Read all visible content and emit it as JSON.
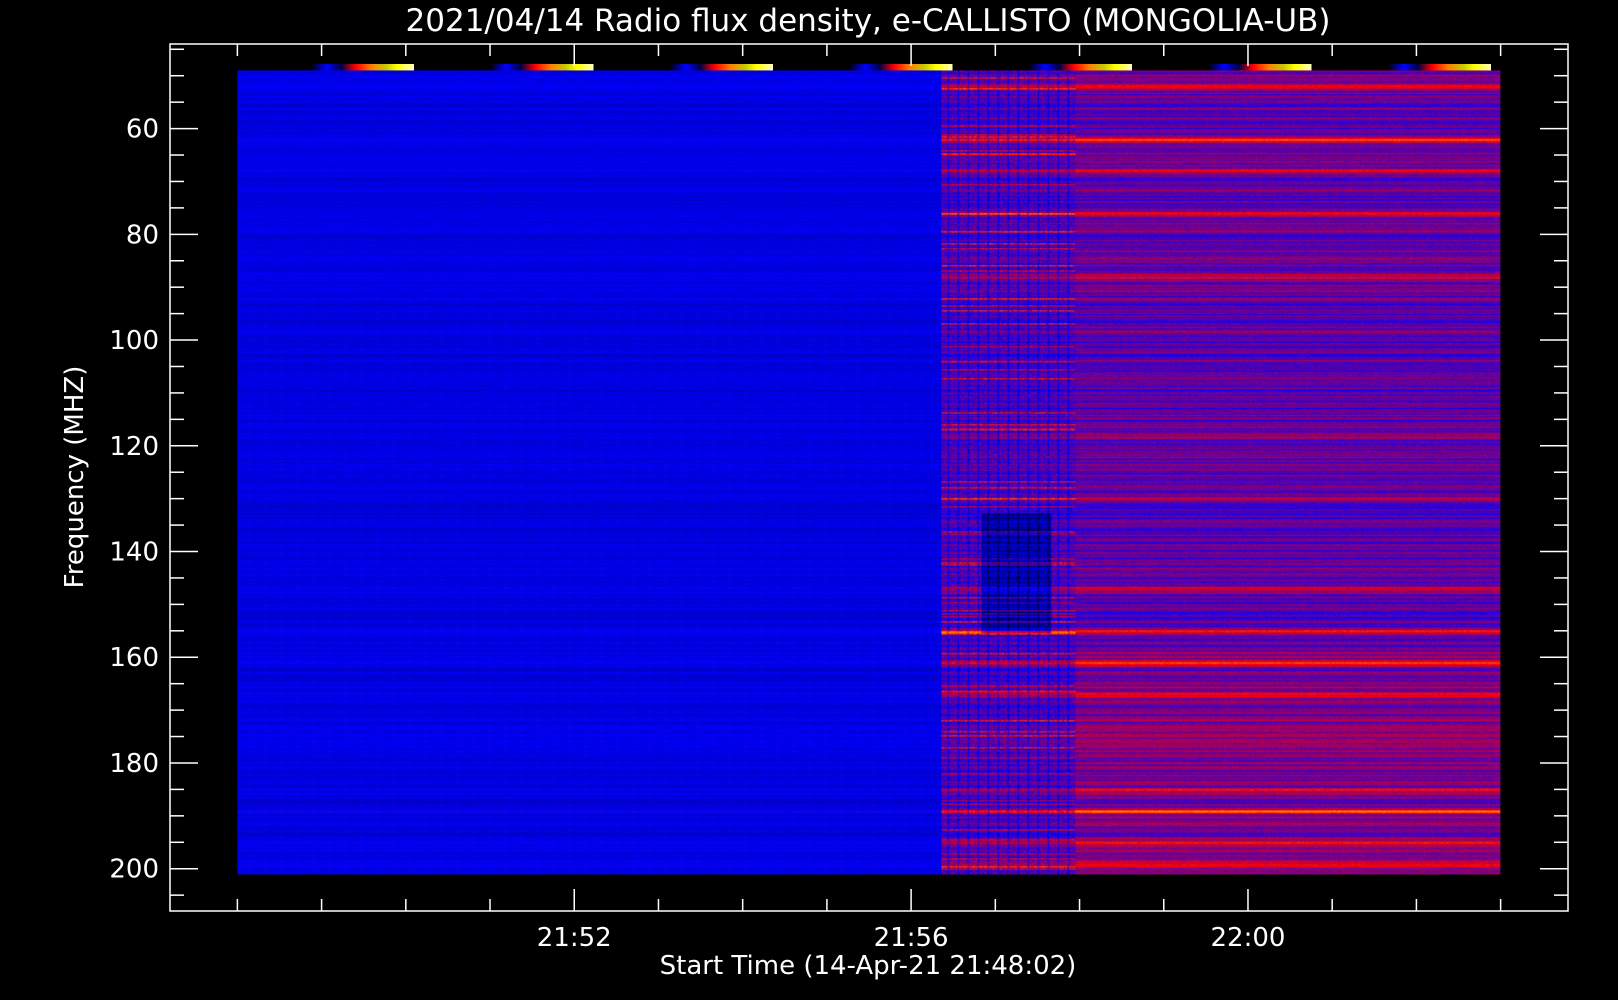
{
  "chart_data": {
    "type": "heatmap",
    "title": "2021/04/14  Radio flux density, e-CALLISTO (MONGOLIA-UB)",
    "xlabel": "Start Time (14-Apr-21 21:48:02)",
    "ylabel": "Frequency (MHZ)",
    "x_ticks": [
      "21:52",
      "21:56",
      "22:00"
    ],
    "y_ticks": [
      "60",
      "80",
      "100",
      "120",
      "140",
      "160",
      "180",
      "200"
    ],
    "x_tick_minutes": [
      4,
      8,
      12
    ],
    "y_tick_values": [
      60,
      80,
      100,
      120,
      140,
      160,
      180,
      200
    ],
    "xlim_minutes": [
      -0.8,
      15.8
    ],
    "ylim": [
      44,
      208
    ],
    "data_time_range_minutes": [
      0,
      15
    ],
    "data_freq_range": [
      49,
      201
    ],
    "colormap": [
      "#000000",
      "#0000ff",
      "#ff0000",
      "#ffff00",
      "#ffffff"
    ],
    "colorbar_count": 7,
    "background_color": "#000000",
    "axis_color": "#ffffff",
    "regions": [
      {
        "name": "quiet",
        "from_minute": 0,
        "to_minute": 8.35,
        "level": "low"
      },
      {
        "name": "broadband-interference",
        "from_minute": 8.35,
        "to_minute": 9.95,
        "level": "variable"
      },
      {
        "name": "elevated",
        "from_minute": 9.95,
        "to_minute": 15,
        "level": "medium"
      }
    ]
  }
}
